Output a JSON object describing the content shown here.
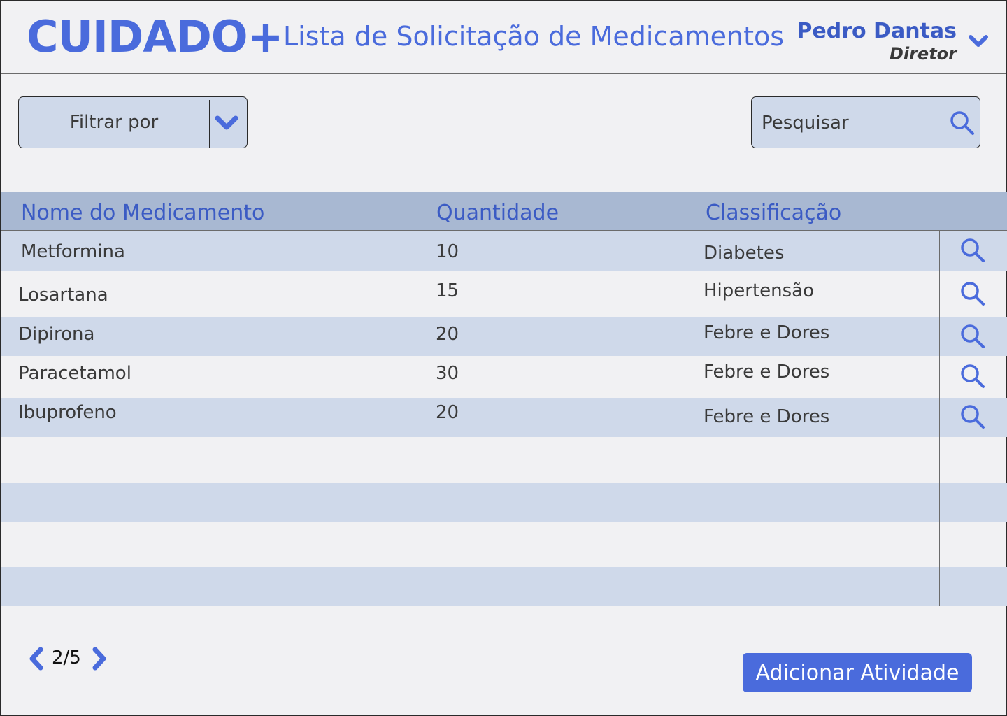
{
  "app": {
    "logo": "CUIDADO+",
    "page_title": "Lista de Solicitação de Medicamentos"
  },
  "user": {
    "name": "Pedro Dantas",
    "role": "Diretor",
    "menu_icon": "chevron-down-icon"
  },
  "toolbar": {
    "filter_label": "Filtrar por",
    "filter_icon": "chevron-down-icon",
    "search_placeholder": "Pesquisar",
    "search_icon": "search-icon"
  },
  "table": {
    "columns": [
      "Nome do Medicamento",
      "Quantidade",
      "Classificação"
    ],
    "rows": [
      {
        "name": "Metformina",
        "quantity": "10",
        "classification": "Diabetes"
      },
      {
        "name": "Losartana",
        "quantity": "15",
        "classification": "Hipertensão"
      },
      {
        "name": "Dipirona",
        "quantity": "20",
        "classification": "Febre e Dores"
      },
      {
        "name": "Paracetamol",
        "quantity": "30",
        "classification": "Febre e Dores"
      },
      {
        "name": "Ibuprofeno",
        "quantity": "20",
        "classification": "Febre e Dores"
      }
    ]
  },
  "pagination": {
    "label": "2/5",
    "current": 2,
    "total": 5
  },
  "actions": {
    "add_label": "Adicionar Atividade"
  },
  "colors": {
    "accent": "#4a6bdc",
    "header_row": "#a8b8d2",
    "row_shade": "#cfd9ea",
    "background": "#f1f1f3"
  }
}
